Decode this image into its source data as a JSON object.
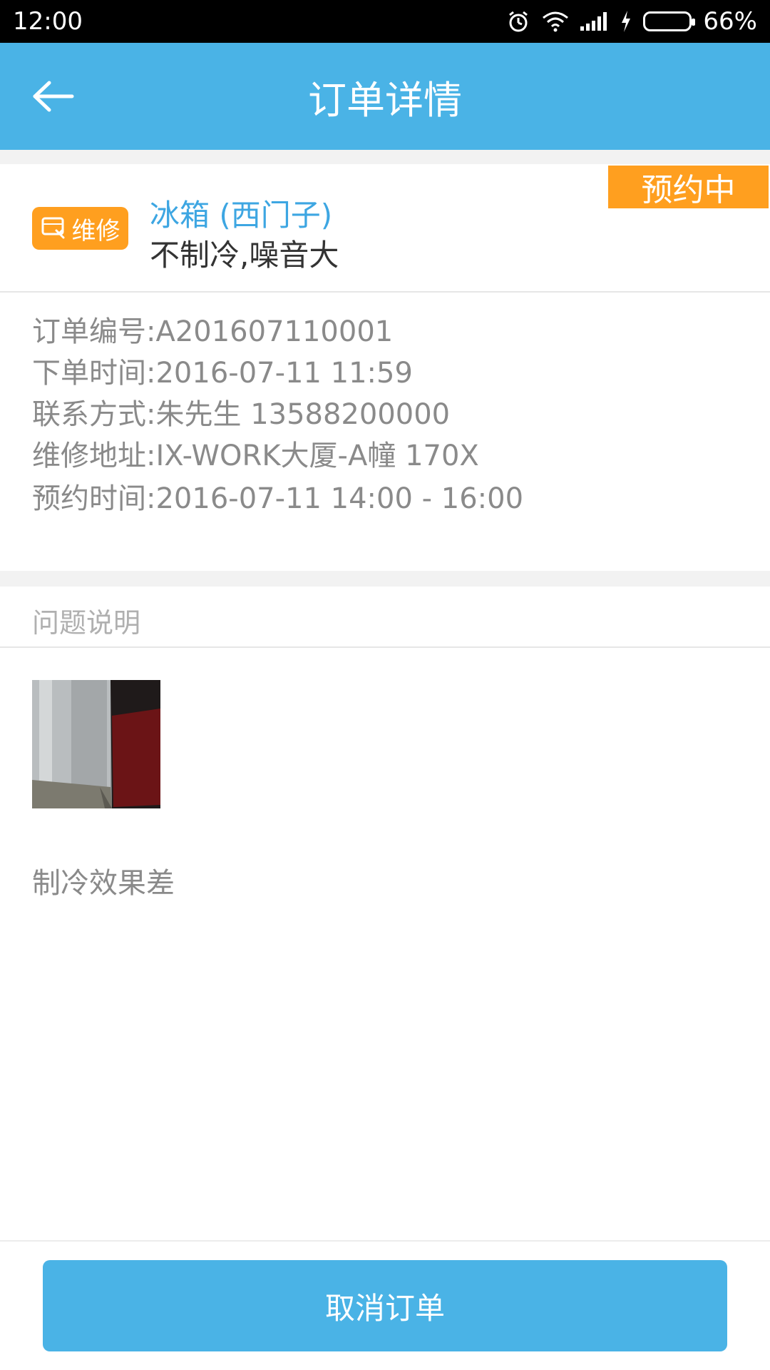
{
  "status_bar": {
    "time": "12:00",
    "battery_percent": "66%",
    "battery_level": 0.66,
    "icons": [
      "alarm-icon",
      "wifi-icon",
      "signal-icon",
      "charging-icon",
      "battery-icon"
    ]
  },
  "header": {
    "title": "订单详情",
    "back_icon": "back-arrow-icon"
  },
  "item": {
    "service_tag": "维修",
    "title": "冰箱 (西门子)",
    "subtitle": "不制冷,噪音大",
    "status": "预约中"
  },
  "order_info": [
    "订单编号:A201607110001",
    "下单时间:2016-07-11 11:59",
    "联系方式:朱先生 13588200000",
    "维修地址:IX-WORK大厦-A幢 170X",
    "预约时间:2016-07-11 14:00 - 16:00"
  ],
  "problem": {
    "section_title": "问题说明",
    "description": "制冷效果差"
  },
  "actions": {
    "cancel_label": "取消订单"
  },
  "colors": {
    "primary": "#4ab3e6",
    "accent_orange": "#ff9f1f",
    "title_blue": "#3da6e2",
    "text_gray": "#8a8a8a"
  }
}
